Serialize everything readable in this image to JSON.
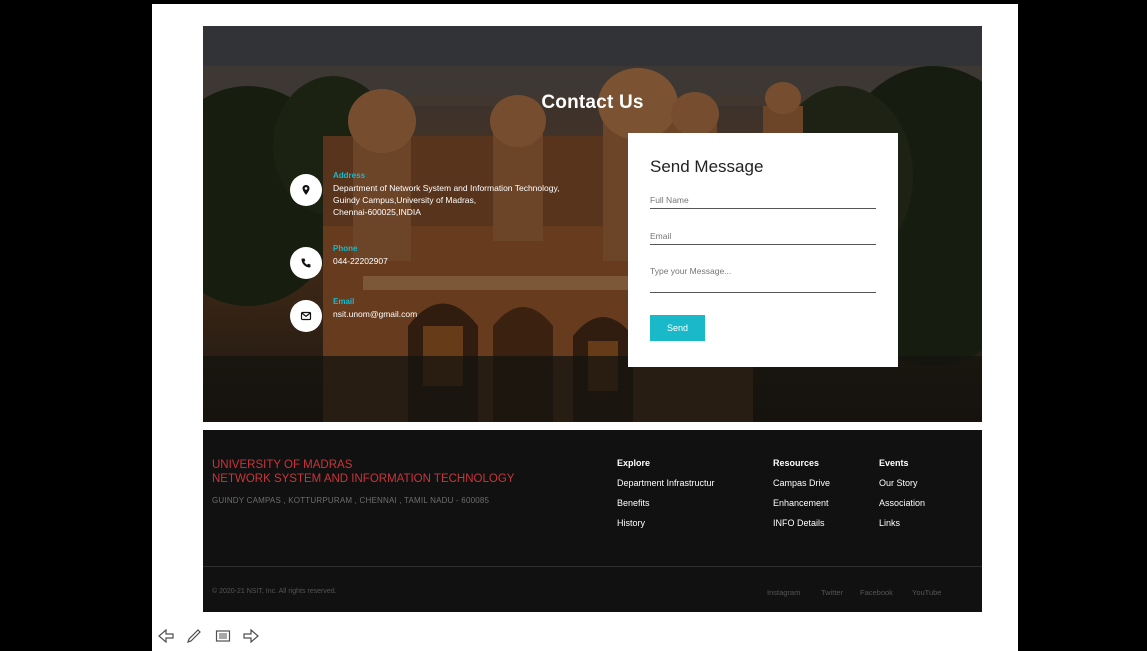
{
  "hero": {
    "title": "Contact Us",
    "address": {
      "label": "Address",
      "lines": [
        "Department of Network System and Information Technology,",
        "Guindy Campus,University of Madras,",
        "Chennai-600025,INDIA"
      ],
      "icon": "map-pin-icon"
    },
    "phone": {
      "label": "Phone",
      "value": "044-22202907",
      "icon": "phone-icon"
    },
    "email": {
      "label": "Email",
      "value": "nsit.unom@gmail.com",
      "icon": "envelope-icon"
    }
  },
  "form": {
    "title": "Send Message",
    "name_placeholder": "Full Name",
    "email_placeholder": "Email",
    "message_placeholder": "Type your Message...",
    "send_label": "Send"
  },
  "footer": {
    "university": "UNIVERSITY OF MADRAS",
    "department": "NETWORK SYSTEM AND INFORMATION TECHNOLOGY",
    "address": "GUINDY CAMPAS , KOTTURPURAM , CHENNAI , TAMIL NADU - 600085",
    "explore": {
      "heading": "Explore",
      "items": [
        "Department Infrastructur",
        "Benefits",
        "History"
      ]
    },
    "resources": {
      "heading": "Resources",
      "items": [
        "Campas Drive",
        "Enhancement",
        "INFO Details"
      ]
    },
    "events": {
      "heading": "Events",
      "items": [
        "Our Story",
        "Association",
        "Links"
      ]
    },
    "copyright": "© 2020-21 NSIT, Inc. All rights reserved.",
    "social": [
      "Instagram",
      "Twitter",
      "Facebook",
      "YouTube"
    ]
  },
  "colors": {
    "accent": "#19b9c9",
    "brand_red": "#c9353a",
    "footer_bg": "#111111"
  },
  "slideshow_nav": [
    "prev-arrow-icon",
    "pen-icon",
    "menu-icon",
    "next-arrow-icon"
  ]
}
